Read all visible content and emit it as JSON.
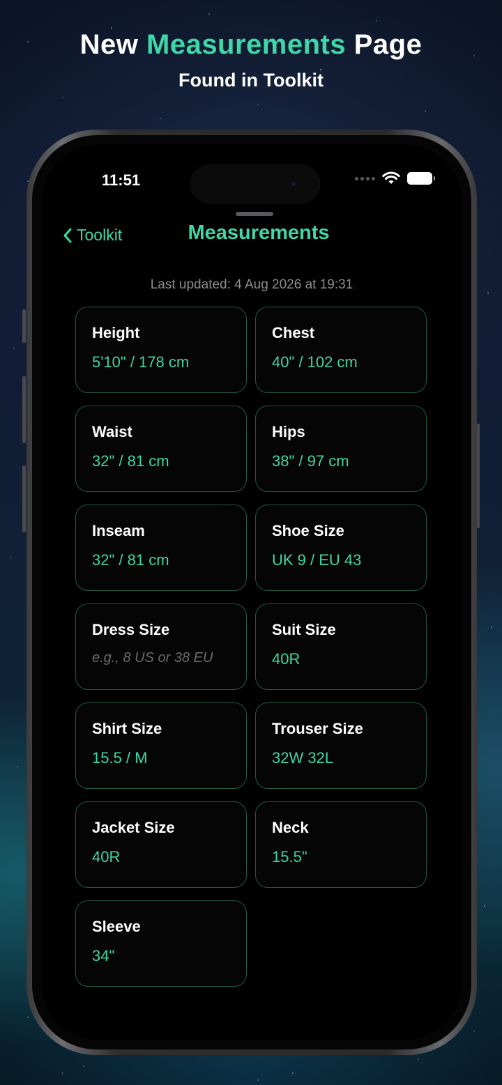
{
  "headline": {
    "prefix": "New ",
    "accent": "Measurements",
    "suffix": " Page",
    "subtitle": "Found in Toolkit"
  },
  "status_bar": {
    "time": "11:51"
  },
  "nav": {
    "back_label": "Toolkit",
    "title": "Measurements"
  },
  "last_updated": "Last updated: 4 Aug 2026 at 19:31",
  "colors": {
    "accent": "#3fd6a8",
    "card_border": "#1f5a48"
  },
  "measurements": [
    {
      "label": "Height",
      "value": "5'10\" / 178 cm"
    },
    {
      "label": "Chest",
      "value": "40\" / 102 cm"
    },
    {
      "label": "Waist",
      "value": "32\" / 81 cm"
    },
    {
      "label": "Hips",
      "value": "38\" / 97 cm"
    },
    {
      "label": "Inseam",
      "value": "32\" / 81 cm"
    },
    {
      "label": "Shoe Size",
      "value": "UK 9 / EU 43"
    },
    {
      "label": "Dress Size",
      "value": "",
      "placeholder": "e.g., 8 US or 38 EU"
    },
    {
      "label": "Suit Size",
      "value": "40R"
    },
    {
      "label": "Shirt Size",
      "value": "15.5 / M"
    },
    {
      "label": "Trouser Size",
      "value": "32W 32L"
    },
    {
      "label": "Jacket Size",
      "value": "40R"
    },
    {
      "label": "Neck",
      "value": "15.5\""
    },
    {
      "label": "Sleeve",
      "value": "34\""
    }
  ]
}
